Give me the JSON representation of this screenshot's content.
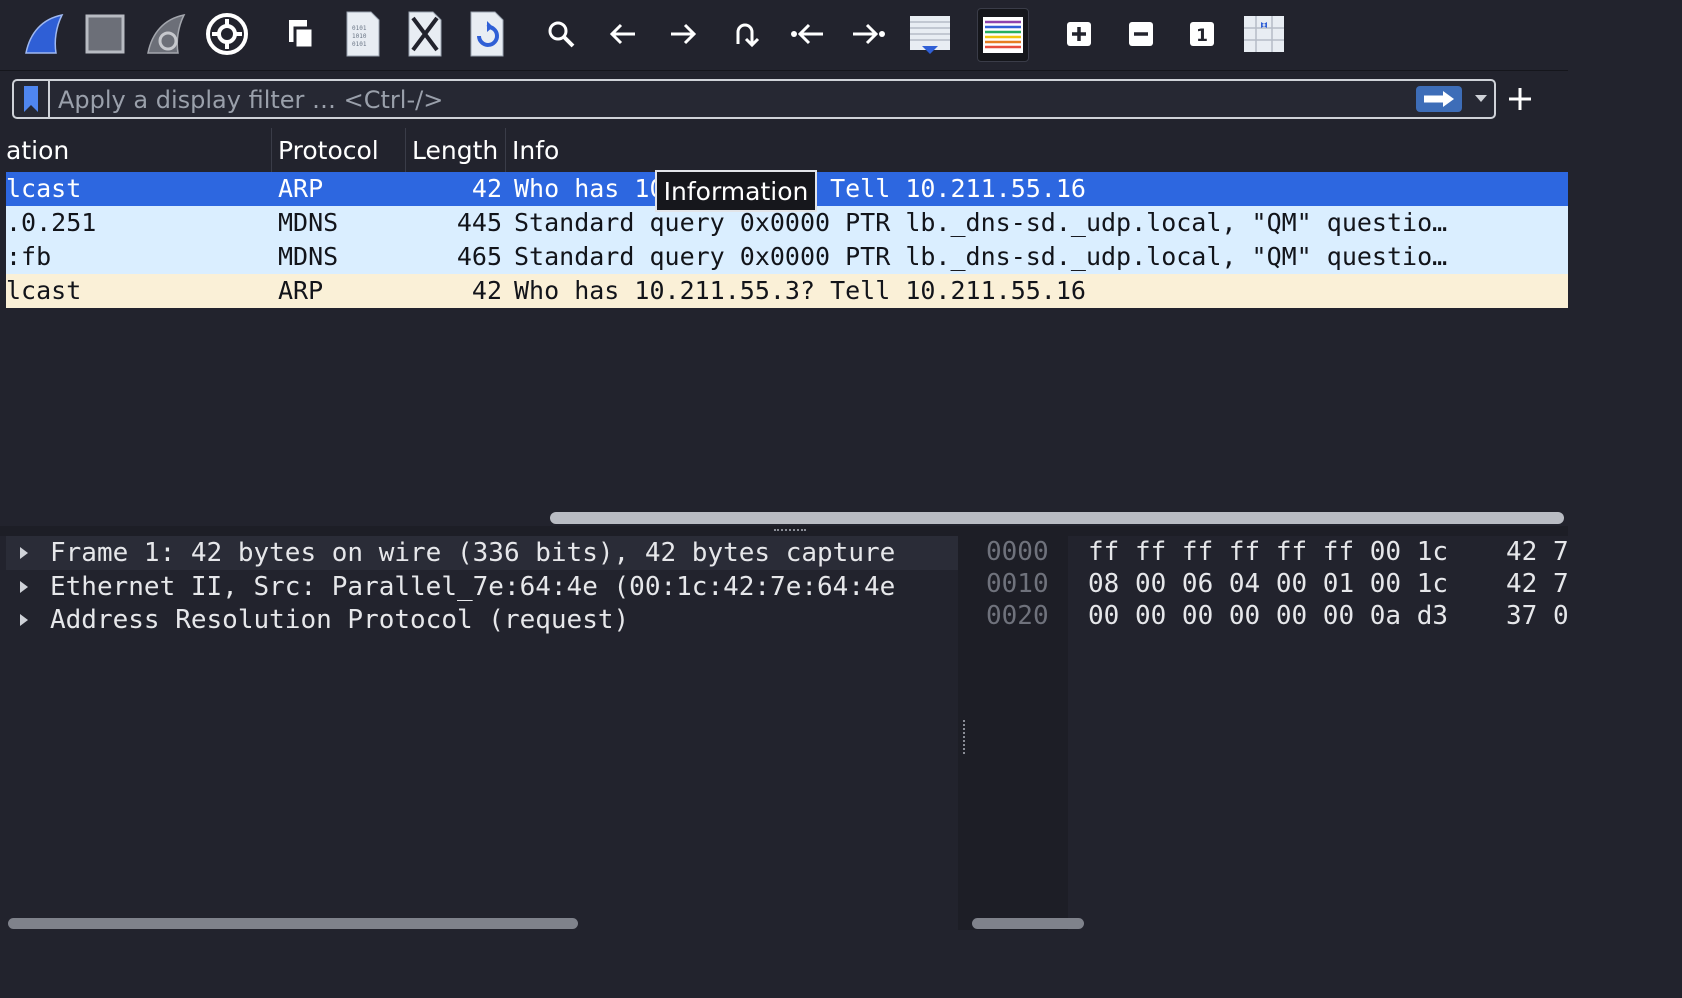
{
  "toolbar": {
    "buttons": [
      {
        "name": "start-capture-icon"
      },
      {
        "name": "stop-capture-icon"
      },
      {
        "name": "restart-capture-icon"
      },
      {
        "name": "capture-options-icon"
      },
      {
        "name": "open-file-icon"
      },
      {
        "name": "save-file-icon"
      },
      {
        "name": "close-file-icon"
      },
      {
        "name": "reload-file-icon"
      },
      {
        "name": "find-packet-icon"
      },
      {
        "name": "go-back-icon"
      },
      {
        "name": "go-forward-icon"
      },
      {
        "name": "go-to-packet-icon"
      },
      {
        "name": "go-first-packet-icon"
      },
      {
        "name": "go-last-packet-icon"
      },
      {
        "name": "auto-scroll-icon"
      },
      {
        "name": "colorize-icon"
      },
      {
        "name": "zoom-in-icon"
      },
      {
        "name": "zoom-out-icon"
      },
      {
        "name": "normal-size-icon"
      },
      {
        "name": "resize-columns-icon"
      }
    ],
    "zoom_normal_label": "1"
  },
  "filter": {
    "placeholder": "Apply a display filter … <Ctrl-/>",
    "value": ""
  },
  "packet_list": {
    "columns": {
      "destination": "ation",
      "protocol": "Protocol",
      "length": "Length",
      "info": "Info"
    },
    "rows": [
      {
        "destination": "lcast",
        "protocol": "ARP",
        "length": "42",
        "info": "Who has 10.211.55.3? Tell 10.211.55.16",
        "state": "selected"
      },
      {
        "destination": ".0.251",
        "protocol": "MDNS",
        "length": "445",
        "info": "Standard query 0x0000 PTR lb._dns-sd._udp.local, \"QM\" questio…",
        "state": "udp"
      },
      {
        "destination": ":fb",
        "protocol": "MDNS",
        "length": "465",
        "info": "Standard query 0x0000 PTR lb._dns-sd._udp.local, \"QM\" questio…",
        "state": "udp"
      },
      {
        "destination": "lcast",
        "protocol": "ARP",
        "length": "42",
        "info": "Who has 10.211.55.3? Tell 10.211.55.16",
        "state": "arp"
      }
    ],
    "tooltip": "Information"
  },
  "details": {
    "rows": [
      "Frame 1: 42 bytes on wire (336 bits), 42 bytes capture",
      "Ethernet II, Src: Parallel_7e:64:4e (00:1c:42:7e:64:4e",
      "Address Resolution Protocol (request)"
    ]
  },
  "bytes": {
    "rows": [
      {
        "offset": "0000",
        "hex": "ff ff ff ff ff ff 00 1c",
        "hex2": "42 7"
      },
      {
        "offset": "0010",
        "hex": "08 00 06 04 00 01 00 1c",
        "hex2": "42 7"
      },
      {
        "offset": "0020",
        "hex": "00 00 00 00 00 00 0a d3",
        "hex2": "37 0"
      }
    ]
  },
  "colors": {
    "selected_row": "#2d67e0",
    "udp_row": "#daeeff",
    "arp_row": "#faf0d7",
    "background": "#22232d"
  }
}
